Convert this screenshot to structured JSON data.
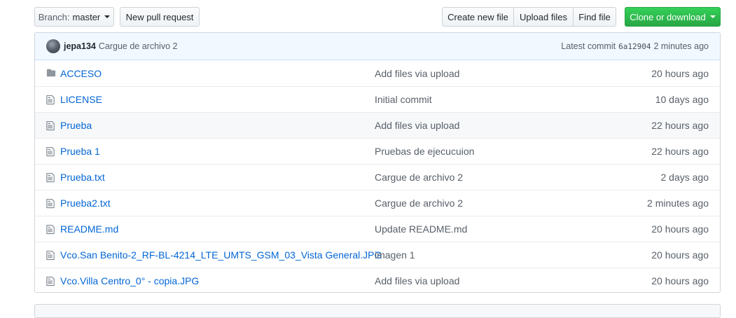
{
  "toolbar": {
    "branch_label": "Branch:",
    "branch_value": "master",
    "new_pr": "New pull request",
    "create_file": "Create new file",
    "upload_files": "Upload files",
    "find_file": "Find file",
    "clone": "Clone or download"
  },
  "commit": {
    "author": "jepa134",
    "message": "Cargue de archivo 2",
    "latest_label": "Latest commit",
    "sha": "6a12904",
    "age": "2 minutes ago"
  },
  "files": [
    {
      "type": "folder",
      "name": "ACCESO",
      "message": "Add files via upload",
      "age": "20 hours ago"
    },
    {
      "type": "file",
      "name": "LICENSE",
      "message": "Initial commit",
      "age": "10 days ago"
    },
    {
      "type": "file",
      "name": "Prueba",
      "message": "Add files via upload",
      "age": "22 hours ago"
    },
    {
      "type": "file",
      "name": "Prueba 1",
      "message": "Pruebas de ejecucuion",
      "age": "22 hours ago"
    },
    {
      "type": "file",
      "name": "Prueba.txt",
      "message": "Cargue de archivo 2",
      "age": "2 days ago"
    },
    {
      "type": "file",
      "name": "Prueba2.txt",
      "message": "Cargue de archivo 2",
      "age": "2 minutes ago"
    },
    {
      "type": "file",
      "name": "README.md",
      "message": "Update README.md",
      "age": "20 hours ago"
    },
    {
      "type": "file",
      "name": "Vco.San Benito-2_RF-BL-4214_LTE_UMTS_GSM_03_Vista General.JPG",
      "message": "imagen 1",
      "age": "20 hours ago"
    },
    {
      "type": "file",
      "name": "Vco.Villa Centro_0° - copia.JPG",
      "message": "Add files via upload",
      "age": "20 hours ago"
    }
  ],
  "colors": {
    "link": "#0366d6",
    "clone_button": "#28a745",
    "commit_bar": "#f1f8ff"
  }
}
